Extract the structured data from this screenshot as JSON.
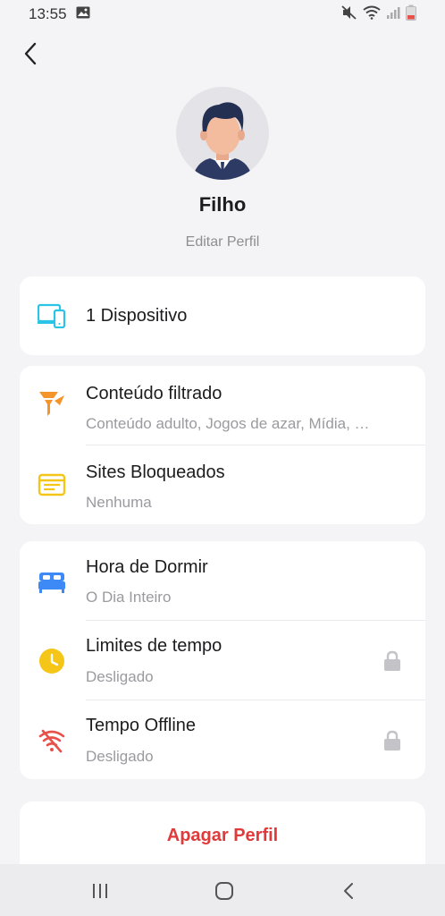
{
  "status_bar": {
    "time": "13:55"
  },
  "profile": {
    "name": "Filho",
    "edit_label": "Editar Perfil"
  },
  "devices": {
    "label": "1 Dispositivo",
    "icon": "devices-icon",
    "color": "#2bc4e6"
  },
  "content_card": {
    "items": [
      {
        "title": "Conteúdo filtrado",
        "subtitle": "Conteúdo adulto, Jogos de azar, Mídia, …",
        "icon": "filter-icon",
        "color": "#f5942a"
      },
      {
        "title": "Sites Bloqueados",
        "subtitle": "Nenhuma",
        "icon": "browser-icon",
        "color": "#f5c518"
      }
    ]
  },
  "time_card": {
    "items": [
      {
        "title": "Hora de Dormir",
        "subtitle": "O Dia Inteiro",
        "icon": "bed-icon",
        "color": "#3d8af7"
      },
      {
        "title": "Limites de tempo",
        "subtitle": "Desligado",
        "icon": "clock-icon",
        "color": "#f5c518",
        "locked": true
      },
      {
        "title": "Tempo Offline",
        "subtitle": "Desligado",
        "icon": "wifi-off-icon",
        "color": "#e8504a",
        "locked": true
      }
    ]
  },
  "delete": {
    "label": "Apagar Perfil",
    "color": "#e03a3a"
  }
}
